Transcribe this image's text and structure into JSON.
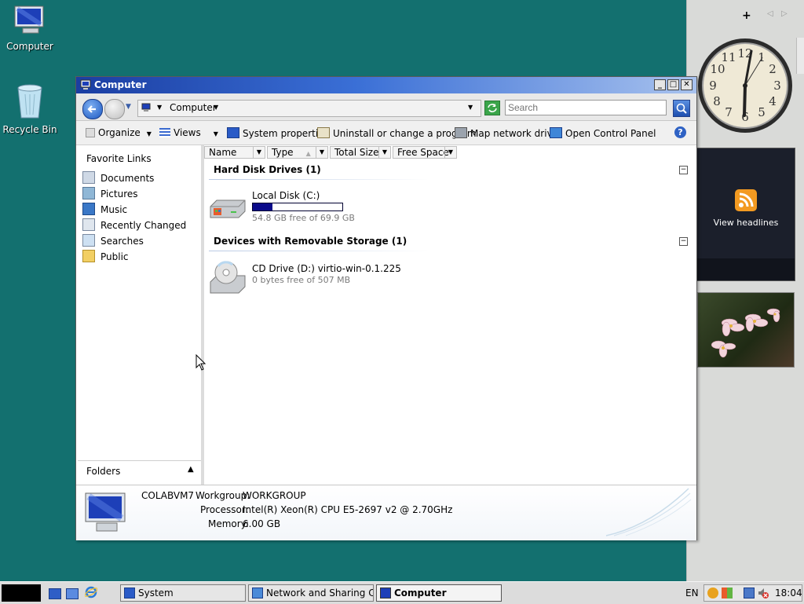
{
  "desktop": {
    "icons": [
      {
        "label": "Computer"
      },
      {
        "label": "Recycle Bin"
      }
    ]
  },
  "sidebar": {
    "controls": {
      "add": "+",
      "prev": "◁",
      "next": "▷"
    },
    "clock": {
      "numbers": [
        "12",
        "1",
        "2",
        "3",
        "4",
        "5",
        "6",
        "7",
        "8",
        "9",
        "10",
        "11"
      ],
      "time": "18:04"
    },
    "feed": {
      "label": "View headlines"
    },
    "slideshow": {
      "alt": "Flowers photo"
    }
  },
  "window": {
    "title": "Computer",
    "address": {
      "path": "Computer",
      "search_placeholder": "Search"
    },
    "toolbar": {
      "organize": "Organize",
      "views": "Views",
      "system_properties": "System properties",
      "uninstall": "Uninstall or change a program",
      "map_drive": "Map network drive",
      "control_panel": "Open Control Panel"
    },
    "nav": {
      "header": "Favorite Links",
      "items": [
        "Documents",
        "Pictures",
        "Music",
        "Recently Changed",
        "Searches",
        "Public"
      ],
      "folders": "Folders"
    },
    "columns": [
      "Name",
      "Type",
      "Total Size",
      "Free Space"
    ],
    "groups": [
      {
        "title": "Hard Disk Drives (1)",
        "items": [
          {
            "name": "Local Disk (C:)",
            "detail": "54.8 GB free of 69.9 GB",
            "used_fraction": 0.216
          }
        ]
      },
      {
        "title": "Devices with Removable Storage (1)",
        "items": [
          {
            "name": "CD Drive (D:) virtio-win-0.1.225",
            "detail": "0 bytes free of 507 MB"
          }
        ]
      }
    ],
    "details": {
      "computer_name": "COLABVM7",
      "workgroup_label": "Workgroup:",
      "workgroup": "WORKGROUP",
      "processor_label": "Processor:",
      "processor": "Intel(R) Xeon(R) CPU E5-2697 v2 @ 2.70GHz",
      "memory_label": "Memory:",
      "memory": "6.00 GB"
    }
  },
  "taskbar": {
    "tasks": [
      {
        "label": "System"
      },
      {
        "label": "Network and Sharing Cen..."
      },
      {
        "label": "Computer"
      }
    ],
    "language": "EN",
    "time": "18:04"
  },
  "colors": {
    "desktop": "#13706f",
    "title_start": "#1b3ea2",
    "bar_fill": "#0a0a8a"
  }
}
